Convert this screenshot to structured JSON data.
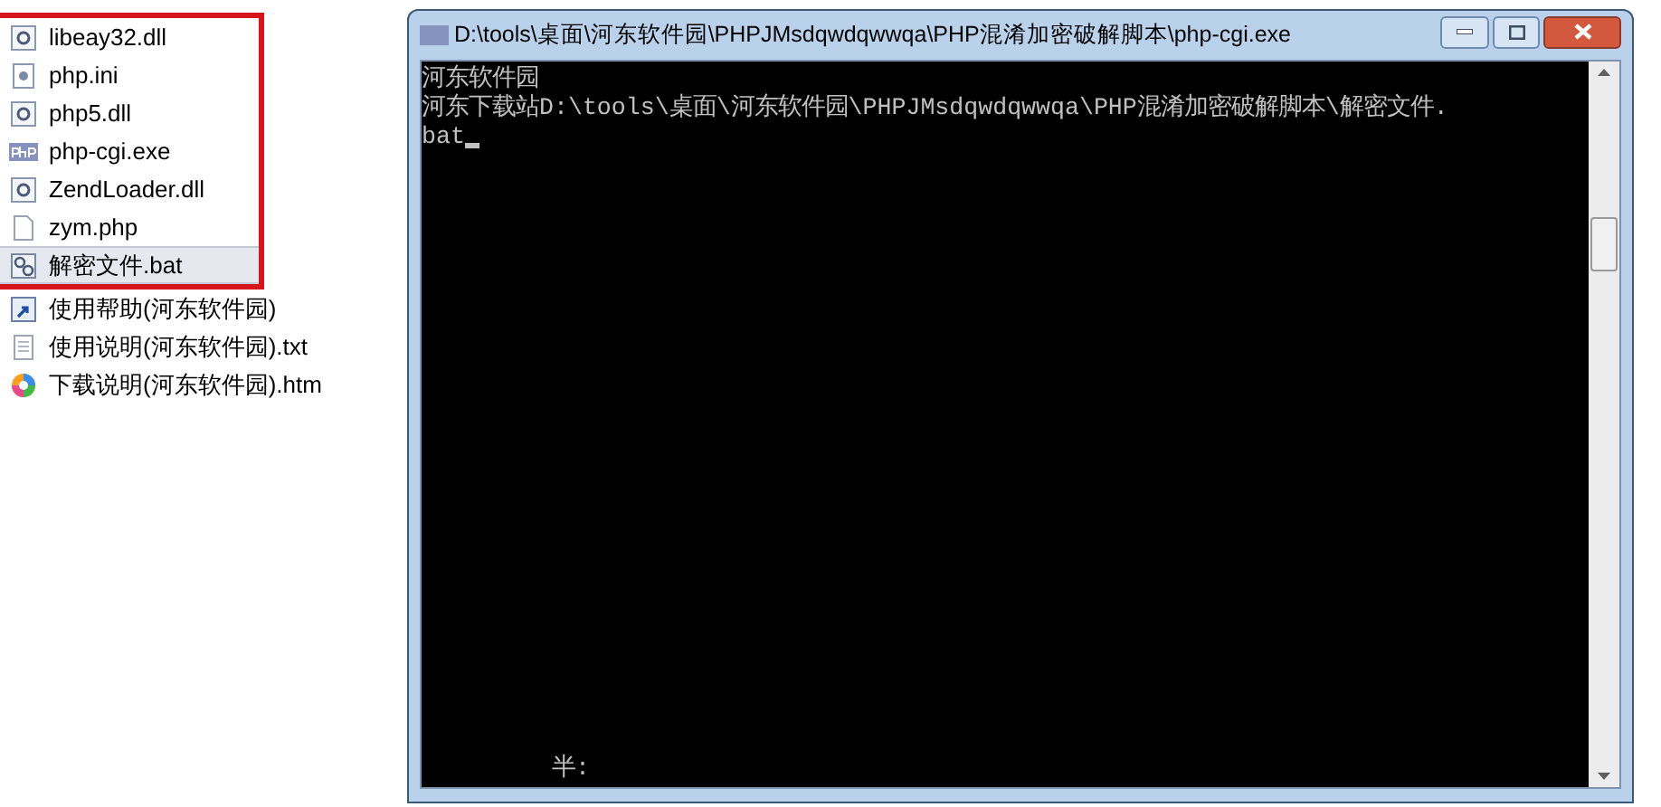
{
  "explorer": {
    "highlighted_files": [
      {
        "name": "libeay32.dll",
        "kind": "dll",
        "selected": false
      },
      {
        "name": "php.ini",
        "kind": "ini",
        "selected": false
      },
      {
        "name": "php5.dll",
        "kind": "dll",
        "selected": false
      },
      {
        "name": "php-cgi.exe",
        "kind": "php",
        "selected": false
      },
      {
        "name": "ZendLoader.dll",
        "kind": "dll",
        "selected": false
      },
      {
        "name": "zym.php",
        "kind": "doc",
        "selected": false
      },
      {
        "name": "解密文件.bat",
        "kind": "bat",
        "selected": true
      }
    ],
    "files": [
      {
        "name": "使用帮助(河东软件园)",
        "kind": "shortcut",
        "selected": false
      },
      {
        "name": "使用说明(河东软件园).txt",
        "kind": "txt",
        "selected": false
      },
      {
        "name": "下载说明(河东软件园).htm",
        "kind": "htm",
        "selected": false
      }
    ]
  },
  "console": {
    "title": "D:\\tools\\桌面\\河东软件园\\PHPJMsdqwdqwwqa\\PHP混淆加密破解脚本\\php-cgi.exe",
    "lines": [
      "河东软件园",
      "河东下载站D:\\tools\\桌面\\河东软件园\\PHPJMsdqwdqwwqa\\PHP混淆加密破解脚本\\解密文件.",
      "bat"
    ],
    "cursor": true,
    "ime_status": "半:"
  }
}
